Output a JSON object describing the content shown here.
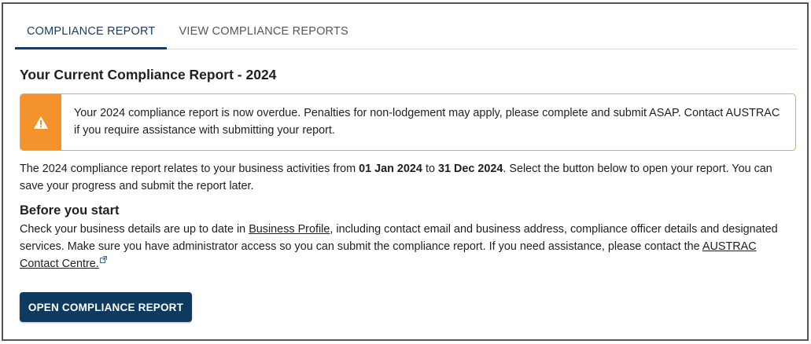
{
  "tabs": [
    {
      "label": "COMPLIANCE REPORT",
      "active": true
    },
    {
      "label": "VIEW COMPLIANCE REPORTS",
      "active": false
    }
  ],
  "heading": "Your Current Compliance Report - 2024",
  "alert": {
    "icon": "warning-icon",
    "text": "Your 2024 compliance report is now overdue. Penalties for non-lodgement may apply, please complete and submit ASAP. Contact AUSTRAC if you require assistance with submitting your report.",
    "accent_color": "#f4932b"
  },
  "intro": {
    "prefix": "The 2024 compliance report relates to your business activities from ",
    "start_date": "01 Jan 2024",
    "middle": " to ",
    "end_date": "31 Dec 2024",
    "suffix": ". Select the button below to open your report. You can save your progress and submit the report later."
  },
  "before_start": {
    "title": "Before you start",
    "text_1": "Check your business details are up to date in ",
    "link_1": "Business Profile",
    "text_2": ", including contact email and business address, compliance officer details and designated services. Make sure you have administrator access so you can submit the compliance report. If you need assistance, please contact the ",
    "link_2": "AUSTRAC Contact Centre."
  },
  "button": {
    "label": "OPEN COMPLIANCE REPORT",
    "color": "#0e3a5f"
  }
}
